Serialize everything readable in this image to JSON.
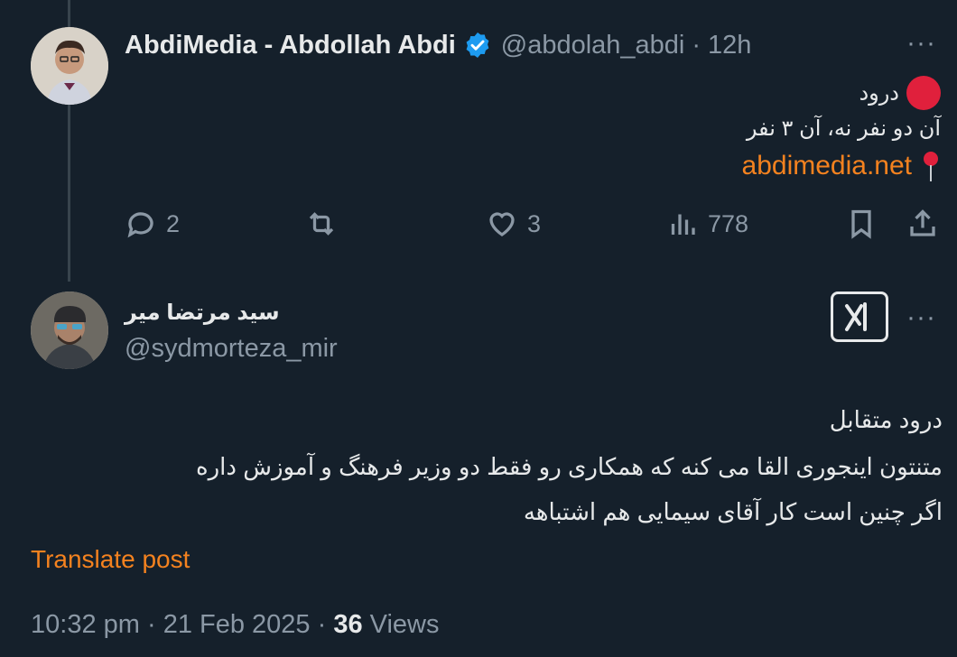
{
  "tweet1": {
    "display_name": "AbdiMedia - Abdollah Abdi",
    "handle": "@abdolah_abdi",
    "separator": "·",
    "time": "12h",
    "more": "···",
    "line1": "درود",
    "line2": "آن دو نفر نه، آن ۳ نفر",
    "link": "abdimedia.net",
    "actions": {
      "replies": "2",
      "likes": "3",
      "views": "778"
    },
    "icons": [
      "verified-badge-icon",
      "red-circle-icon",
      "pin-icon",
      "reply-icon",
      "retweet-icon",
      "like-icon",
      "views-icon",
      "bookmark-icon",
      "share-icon"
    ]
  },
  "tweet2": {
    "display_name": "سید مرتضا میر",
    "handle": "@sydmorteza_mir",
    "more": "···",
    "body": [
      "درود متقابل",
      "متنتون اینجوری القا می کنه که همکاری رو فقط دو وزیر فرهنگ و آموزش داره",
      "اگر چنین است کار آقای سیمایی هم اشتباهه"
    ],
    "translate": "Translate post",
    "time": "10:32 pm",
    "date": "21 Feb 2025",
    "views_count": "36",
    "views_label": "Views"
  },
  "colors": {
    "background": "#15202b",
    "accent": "#f4821f",
    "muted": "#8b98a5",
    "verified": "#1d9bf0"
  }
}
